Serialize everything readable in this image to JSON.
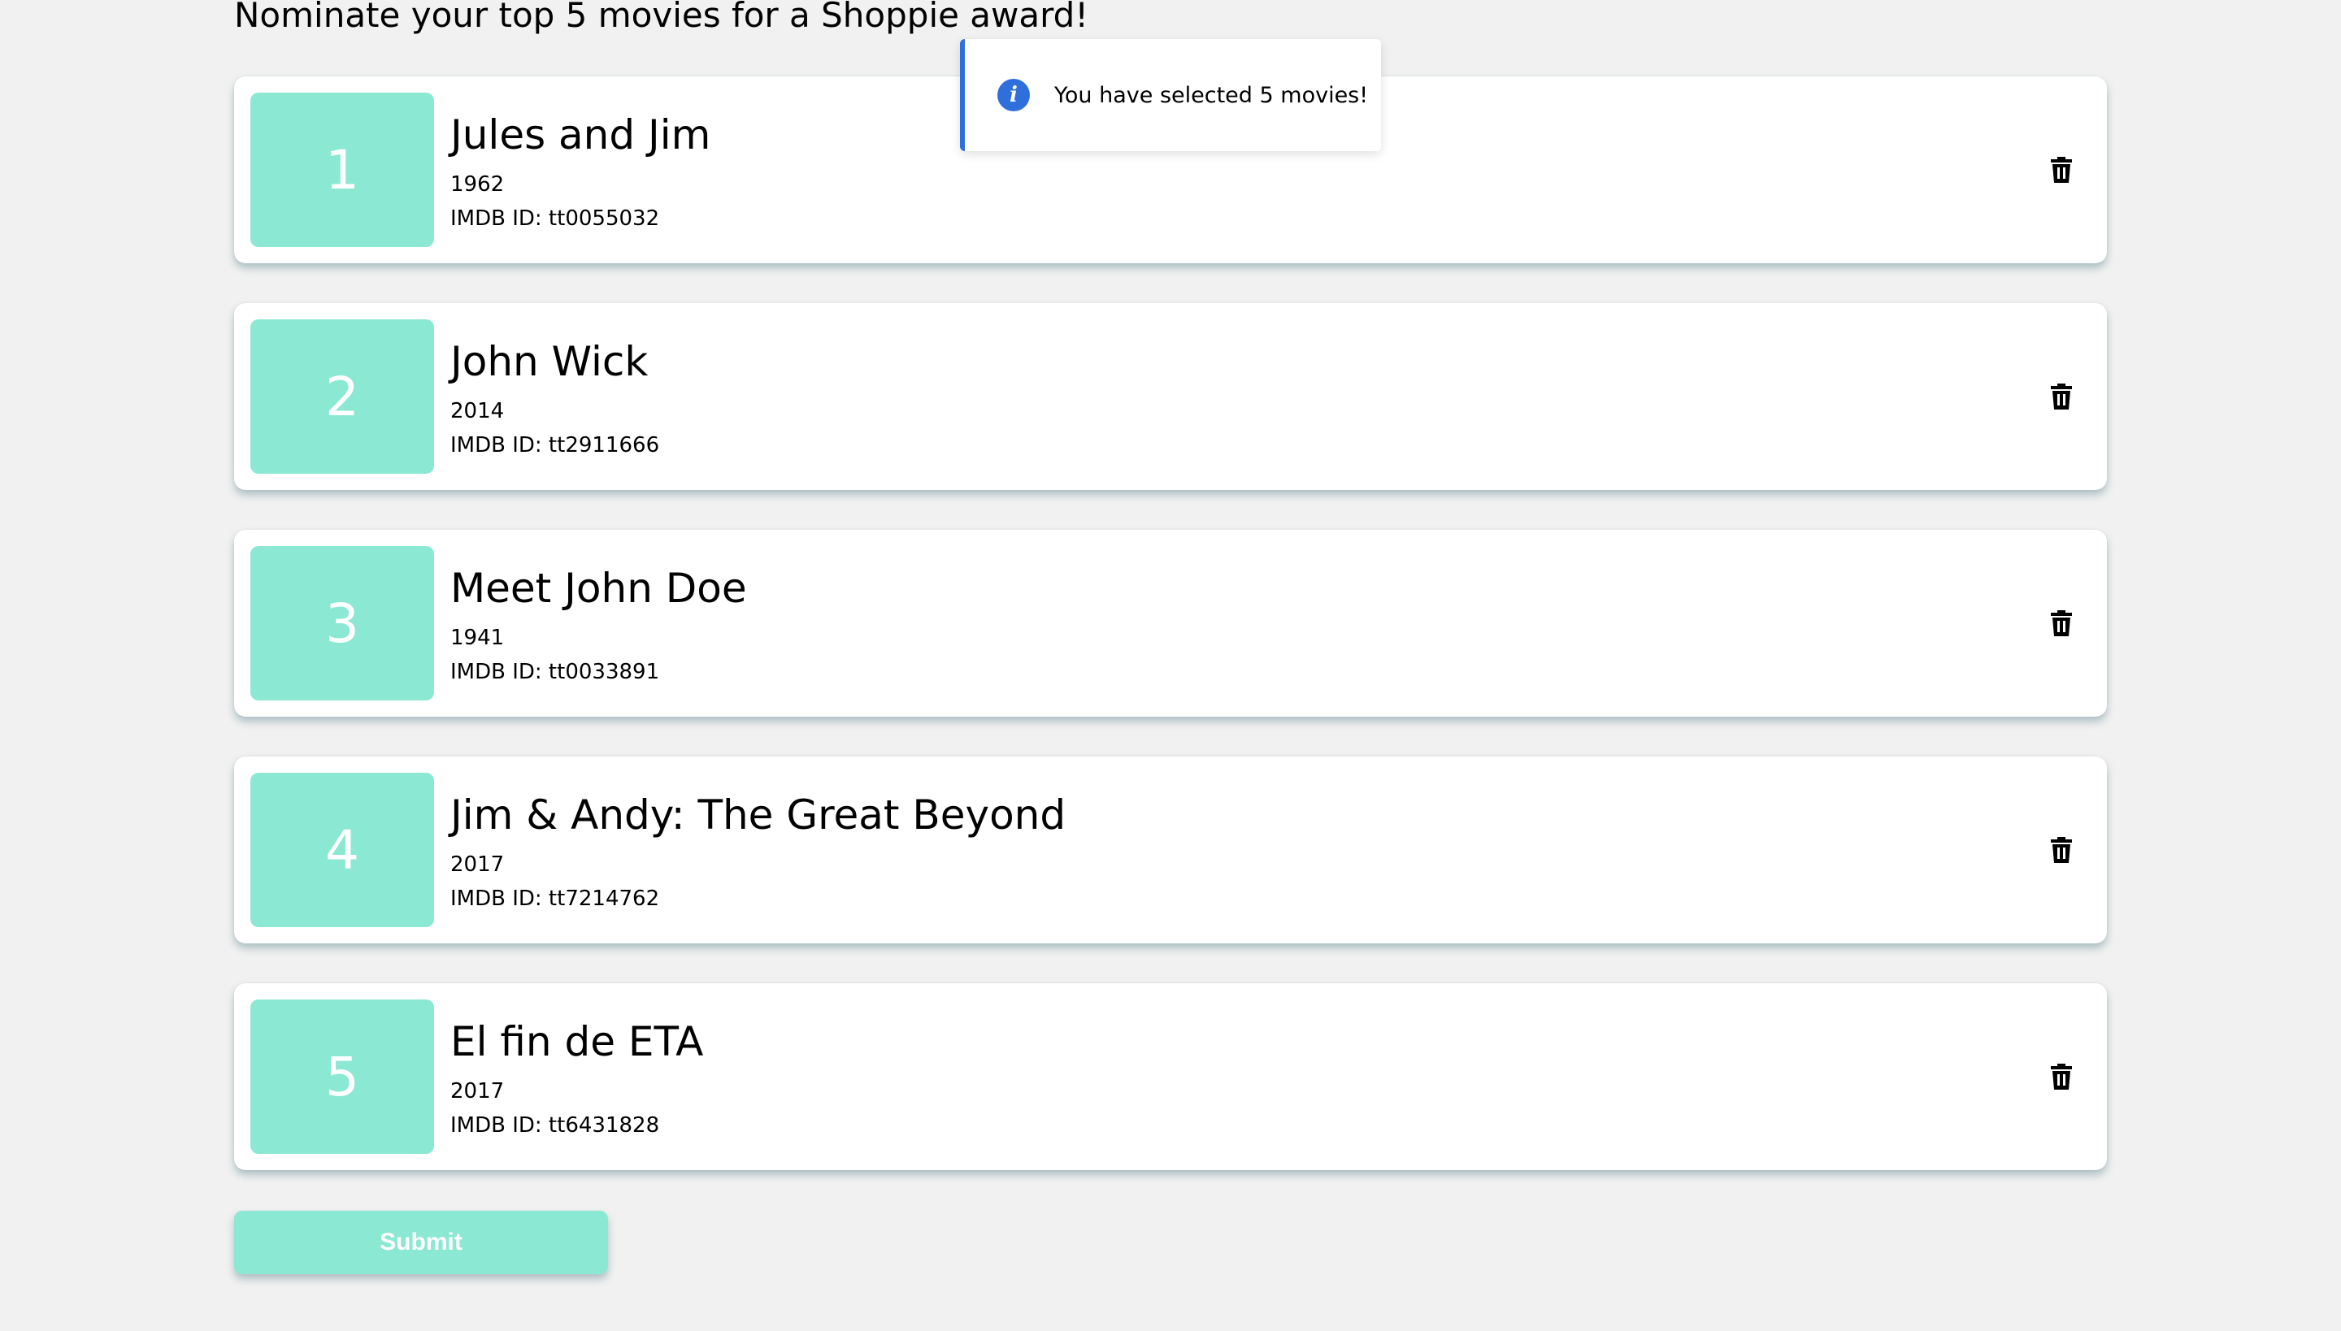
{
  "heading": "Nominate your top 5 movies for a Shoppie award!",
  "colors": {
    "accent": "#8be8d3",
    "toast_border": "#2f6fdc",
    "info_icon": "#2f6fdc",
    "background": "#f1f1f1"
  },
  "toast": {
    "icon": "info-icon",
    "message": "You have selected 5 movies!"
  },
  "nominations": [
    {
      "rank": "1",
      "title": "Jules and Jim",
      "year": "1962",
      "imdb": "IMDB ID: tt0055032"
    },
    {
      "rank": "2",
      "title": "John Wick",
      "year": "2014",
      "imdb": "IMDB ID: tt2911666"
    },
    {
      "rank": "3",
      "title": "Meet John Doe",
      "year": "1941",
      "imdb": "IMDB ID: tt0033891"
    },
    {
      "rank": "4",
      "title": "Jim & Andy: The Great Beyond",
      "year": "2017",
      "imdb": "IMDB ID: tt7214762"
    },
    {
      "rank": "5",
      "title": "El fin de ETA",
      "year": "2017",
      "imdb": "IMDB ID: tt6431828"
    }
  ],
  "delete_icon": "trash-icon",
  "submit_label": "Submit"
}
